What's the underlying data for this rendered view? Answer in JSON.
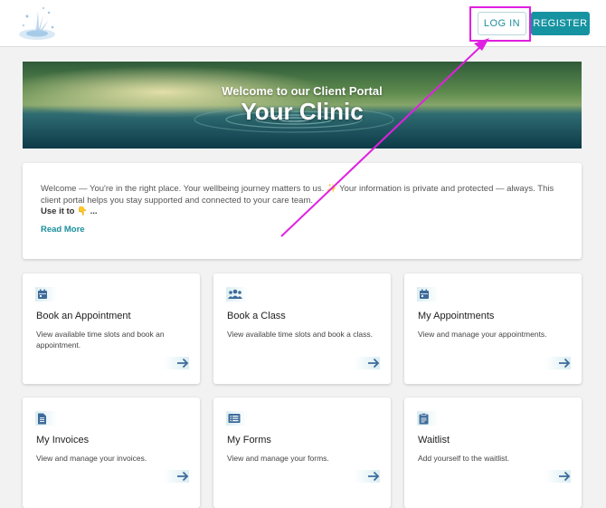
{
  "header": {
    "login_label": "LOG IN",
    "register_label": "REGISTER"
  },
  "hero": {
    "subtitle": "Welcome to our Client Portal",
    "title": "Your Clinic"
  },
  "welcome": {
    "text": "Welcome — You're in the right place. Your wellbeing journey matters to us. ✨ Your information is private and protected — always. This client portal helps you stay supported and connected to your care team.",
    "use_it": "Use it to 👇 ...",
    "read_more": "Read More"
  },
  "cards": [
    {
      "title": "Book an Appointment",
      "desc": "View available time slots and book an appointment.",
      "icon": "calendar-icon"
    },
    {
      "title": "Book a Class",
      "desc": "View available time slots and book a class.",
      "icon": "group-icon"
    },
    {
      "title": "My Appointments",
      "desc": "View and manage your appointments.",
      "icon": "calendar-icon"
    },
    {
      "title": "My Invoices",
      "desc": "View and manage your invoices.",
      "icon": "document-icon"
    },
    {
      "title": "My Forms",
      "desc": "View and manage your forms.",
      "icon": "list-icon"
    },
    {
      "title": "Waitlist",
      "desc": "Add yourself to the waitlist.",
      "icon": "clipboard-icon"
    }
  ],
  "colors": {
    "accent": "#1693a1",
    "icon": "#3d6b9a",
    "annotation": "#e020e0"
  }
}
